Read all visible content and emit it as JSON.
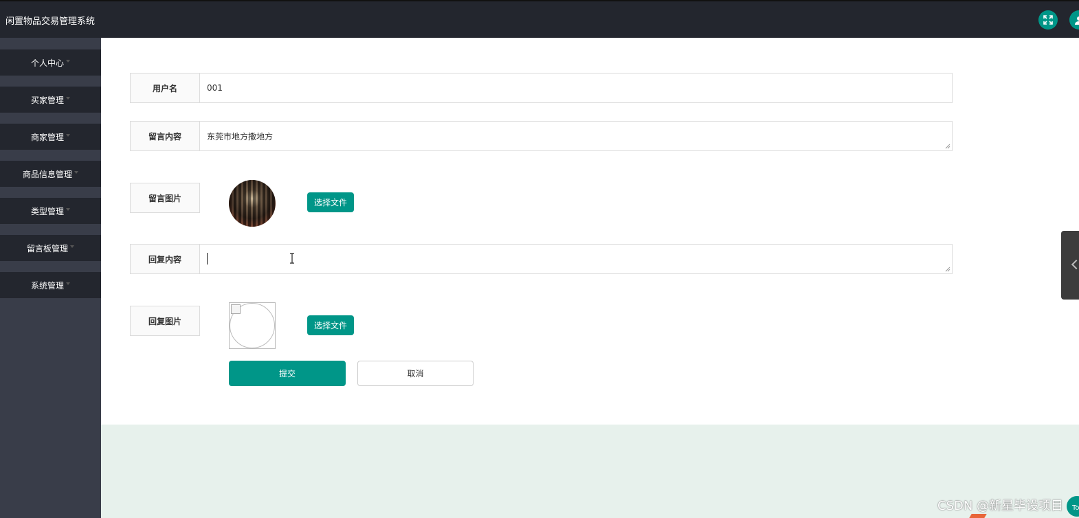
{
  "header": {
    "title": "闲置物品交易管理系统"
  },
  "sidebar": {
    "items": [
      {
        "label": "个人中心"
      },
      {
        "label": "买家管理"
      },
      {
        "label": "商家管理"
      },
      {
        "label": "商品信息管理"
      },
      {
        "label": "类型管理"
      },
      {
        "label": "留言板管理"
      },
      {
        "label": "系统管理"
      }
    ]
  },
  "form": {
    "username": {
      "label": "用户名",
      "value": "001"
    },
    "message": {
      "label": "留言内容",
      "value": "东莞市地方撒地方"
    },
    "message_image": {
      "label": "留言图片",
      "button": "选择文件"
    },
    "reply": {
      "label": "回复内容",
      "value": ""
    },
    "reply_image": {
      "label": "回复图片",
      "button": "选择文件"
    },
    "submit_label": "提交",
    "cancel_label": "取消"
  },
  "watermark": "CSDN @新星毕设项目",
  "corner_button_text": "To",
  "colors": {
    "header_bg": "#23262e",
    "sidebar_bg": "#393d49",
    "menu_item_bg": "#23262e",
    "accent": "#009688",
    "lower_bg": "#e7f1ec"
  },
  "icons": {
    "fullscreen": "fullscreen-icon",
    "user": "user-icon"
  }
}
